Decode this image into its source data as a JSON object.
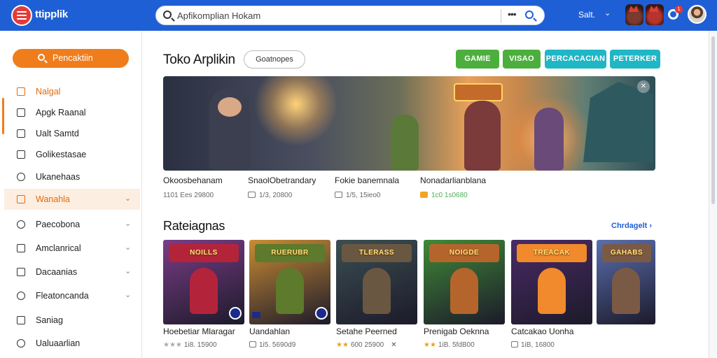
{
  "header": {
    "app_title": "ttipplik",
    "search": {
      "value": "Apfikomplian Hokam"
    },
    "user_name": "Salt.",
    "notification_count": "1"
  },
  "sidebar": {
    "search_label": "Pencaktiin",
    "items": [
      {
        "label": "Nalgal",
        "icon": "square-icon",
        "style": "orange",
        "chevron": false
      },
      {
        "label": "Apgk Raanal",
        "icon": "square-icon",
        "style": "normal",
        "chevron": false
      },
      {
        "label": "Ualt Samtd",
        "icon": "square-icon",
        "style": "normal",
        "chevron": false
      },
      {
        "label": "Golikestasae",
        "icon": "square-icon",
        "style": "normal",
        "chevron": false
      },
      {
        "label": "Ukanehaas",
        "icon": "circle-icon",
        "style": "normal",
        "chevron": false
      },
      {
        "label": "Wanahla",
        "icon": "square-icon",
        "style": "active",
        "chevron": true
      },
      {
        "label": "Paecobona",
        "icon": "circle-icon",
        "style": "normal",
        "chevron": true
      },
      {
        "label": "Amclanrical",
        "icon": "square-icon",
        "style": "normal",
        "chevron": true
      },
      {
        "label": "Dacaanias",
        "icon": "square-icon",
        "style": "normal",
        "chevron": true
      },
      {
        "label": "Fleatoncanda",
        "icon": "circle-icon",
        "style": "normal",
        "chevron": true
      },
      {
        "label": "Saniag",
        "icon": "square-icon",
        "style": "normal",
        "chevron": false
      },
      {
        "label": "Ualuaarlian",
        "icon": "circle-icon",
        "style": "normal",
        "chevron": false
      }
    ]
  },
  "main": {
    "title": "Toko Arplikin",
    "filter_pill": "Goatnopes",
    "tabs": [
      {
        "label": "GAMIE",
        "color": "#4caf3d"
      },
      {
        "label": "VISAO",
        "color": "#4caf3d"
      },
      {
        "label": "PERCACACIAN",
        "color": "#1fb6c6"
      },
      {
        "label": "PETERKER",
        "color": "#1fb6c6"
      }
    ],
    "featured": [
      {
        "title": "Okoosbehanam",
        "meta": "1101 Ees 29800",
        "icon": false,
        "green": false
      },
      {
        "title": "SnaolObetrandary",
        "meta": "1/3, 20800",
        "icon": true,
        "green": false
      },
      {
        "title": "Fokie banemnala",
        "meta": "1/5, 15ieo0",
        "icon": true,
        "green": false
      },
      {
        "title": "Nonadarlianblana",
        "meta": "1c0 1s0680",
        "icon": true,
        "green": true
      }
    ],
    "section": {
      "title": "Rateiagnas",
      "link": "Chrdagelt ›"
    },
    "cards": [
      {
        "name": "Hoebetiar Mlaragar",
        "meta": "1i8. 15900",
        "banner": "NOILLS",
        "stars": "★★★",
        "star_grey": true,
        "icon": false,
        "close": false,
        "bg": "#7a3d87",
        "accent": "#b3243b"
      },
      {
        "name": "Uandahlan",
        "meta": "1i5. 5690d9",
        "banner": "RUERUBR",
        "stars": "",
        "star_grey": false,
        "icon": true,
        "close": false,
        "bg": "#c98c34",
        "accent": "#5e7a2c"
      },
      {
        "name": "Setahe Peerned",
        "meta": "600 25900",
        "banner": "TLERASS",
        "stars": "★★",
        "star_grey": false,
        "icon": false,
        "close": true,
        "bg": "#3b4f52",
        "accent": "#6a5741"
      },
      {
        "name": "Prenigab Oeknna",
        "meta": "1iB. 5fdB00",
        "banner": "NOIGDE",
        "stars": "★★",
        "star_grey": false,
        "icon": false,
        "close": false,
        "bg": "#3f8a38",
        "accent": "#b5652c"
      },
      {
        "name": "Catcakao Uonha",
        "meta": "1iB, 16800",
        "banner": "TREACAK",
        "stars": "",
        "star_grey": false,
        "icon": true,
        "close": false,
        "bg": "#4a2b66",
        "accent": "#f08a2c"
      },
      {
        "name": "",
        "meta": "",
        "banner": "GAHABS",
        "stars": "",
        "star_grey": false,
        "icon": false,
        "close": false,
        "bg": "#5a6fb0",
        "accent": "#7b5a45"
      }
    ]
  }
}
